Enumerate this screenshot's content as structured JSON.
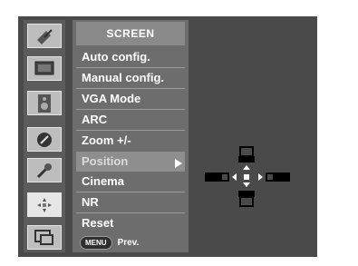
{
  "menu": {
    "title": "SCREEN",
    "items": [
      {
        "label": "Auto config."
      },
      {
        "label": "Manual config."
      },
      {
        "label": "VGA Mode"
      },
      {
        "label": "ARC"
      },
      {
        "label": "Zoom +/-"
      },
      {
        "label": "Position"
      },
      {
        "label": "Cinema"
      },
      {
        "label": "NR"
      },
      {
        "label": "Reset"
      }
    ],
    "selected_item": "Position"
  },
  "sidebar": {
    "icons": [
      {
        "name": "satellite-dish-icon"
      },
      {
        "name": "monitor-icon"
      },
      {
        "name": "speaker-icon"
      },
      {
        "name": "clock-icon"
      },
      {
        "name": "wrench-icon"
      },
      {
        "name": "screen-adjust-icon"
      },
      {
        "name": "pip-icon"
      }
    ],
    "selected_icon": "screen-adjust-icon"
  },
  "footer": {
    "menu_key": "MENU",
    "prev_label": "Prev."
  },
  "colors": {
    "panel": "#6d6d6d",
    "highlight": "#8e8e8e",
    "background": "#4a4a4a"
  }
}
